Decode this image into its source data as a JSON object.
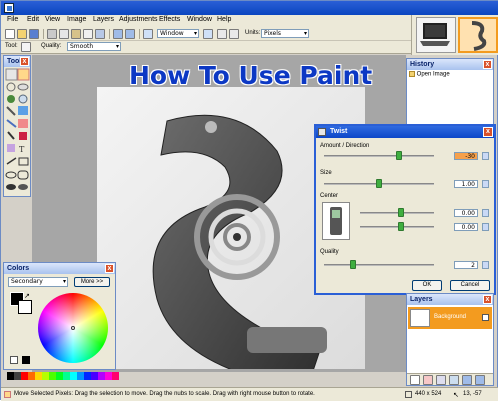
{
  "headline": "How To Use Paint",
  "menubar": [
    "File",
    "Edit",
    "View",
    "Image",
    "Layers",
    "Adjustments",
    "Effects",
    "Window",
    "Help"
  ],
  "toolbar": {
    "zoom_value": "Window",
    "units_label": "Units:",
    "units_value": "Pixels",
    "tool_label": "Tool:",
    "quality_label": "Quality:",
    "quality_value": "Smooth"
  },
  "tools_panel": {
    "title": "Tools",
    "close": "x"
  },
  "history_panel": {
    "title": "History",
    "close": "x",
    "items": [
      "Open Image"
    ]
  },
  "layers_panel": {
    "title": "Layers",
    "close": "x",
    "layer_name": "Background"
  },
  "colors_panel": {
    "title": "Colors",
    "close": "x",
    "mode_value": "Secondary",
    "more_label": "More >>"
  },
  "twist_dialog": {
    "title": "Twist",
    "close": "x",
    "amount_label": "Amount / Direction",
    "amount_value": "-30",
    "size_label": "Size",
    "size_value": "1.00",
    "center_label": "Center",
    "center_x": "0.00",
    "center_y": "0.00",
    "quality_label": "Quality",
    "quality_value": "2",
    "ok_label": "OK",
    "cancel_label": "Cancel"
  },
  "statusbar": {
    "hint": "Move Selected Pixels: Drag the selection to move. Drag the nubs to scale. Drag with right mouse button to rotate.",
    "size": "440 x 524",
    "position": "13, -57"
  },
  "colors": {
    "titlebar": "#0a45c0",
    "headline": "#0c38c4",
    "accent": "#f39b1f",
    "panel": "#ece9d8"
  }
}
